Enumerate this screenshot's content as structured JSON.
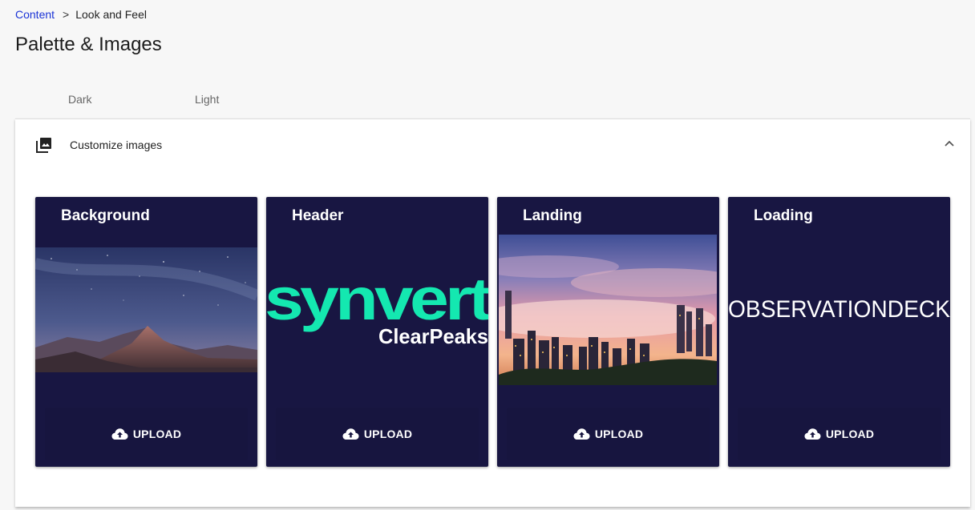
{
  "breadcrumb": {
    "parent": "Content",
    "separator": ">",
    "current": "Look and Feel"
  },
  "page_title": "Palette & Images",
  "tabs": [
    {
      "label": "Dark"
    },
    {
      "label": "Light"
    }
  ],
  "panel": {
    "title": "Customize images",
    "icon": "photo-library-icon",
    "toggle_icon": "chevron-up-icon"
  },
  "cards": [
    {
      "title": "Background",
      "image": "starry-mountain-photo",
      "upload_label": "UPLOAD"
    },
    {
      "title": "Header",
      "image": "synvert-clearpeaks-logo",
      "logo_main": "synvert",
      "logo_sub": "ClearPeaks",
      "upload_label": "UPLOAD"
    },
    {
      "title": "Landing",
      "image": "city-skyline-fog-photo",
      "upload_label": "UPLOAD"
    },
    {
      "title": "Loading",
      "image": "observationdeck-logo",
      "logo_main": "OBSERVATIONDECK",
      "upload_label": "UPLOAD"
    }
  ],
  "colors": {
    "card_bg": "#181642",
    "link": "#1a33d6",
    "logo_accent": "#14e8b0"
  }
}
